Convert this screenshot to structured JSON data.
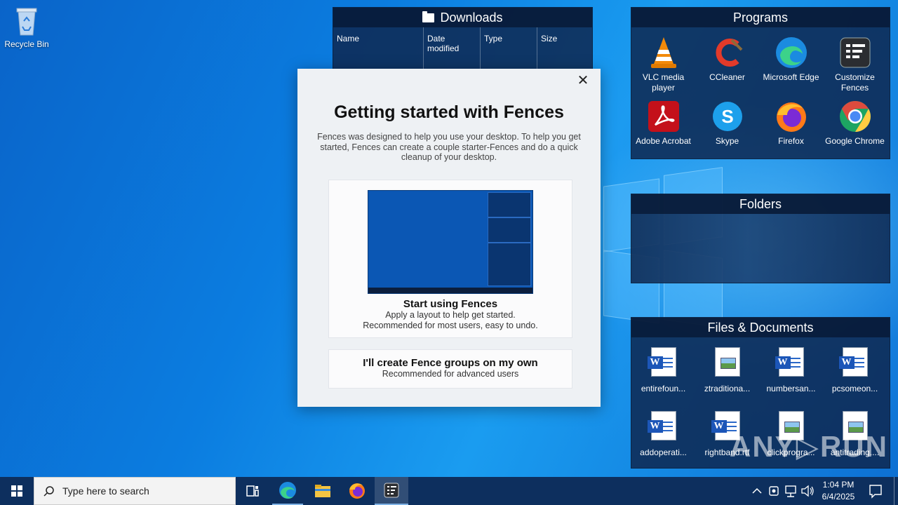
{
  "desktop": {
    "recycle_bin_label": "Recycle Bin"
  },
  "downloads_fence": {
    "title": "Downloads",
    "columns": [
      "Name",
      "Date modified",
      "Type",
      "Size"
    ]
  },
  "programs_fence": {
    "title": "Programs",
    "items": [
      {
        "label": "VLC media player",
        "icon": "vlc-icon"
      },
      {
        "label": "CCleaner",
        "icon": "ccleaner-icon"
      },
      {
        "label": "Microsoft Edge",
        "icon": "edge-icon"
      },
      {
        "label": "Customize Fences",
        "icon": "fences-icon"
      },
      {
        "label": "Adobe Acrobat",
        "icon": "acrobat-icon"
      },
      {
        "label": "Skype",
        "icon": "skype-icon"
      },
      {
        "label": "Firefox",
        "icon": "firefox-icon"
      },
      {
        "label": "Google Chrome",
        "icon": "chrome-icon"
      }
    ]
  },
  "folders_fence": {
    "title": "Folders"
  },
  "files_fence": {
    "title": "Files & Documents",
    "items": [
      {
        "label": "entirefoun...",
        "icon": "word-doc-icon"
      },
      {
        "label": "ztraditiona...",
        "icon": "image-file-icon"
      },
      {
        "label": "numbersan...",
        "icon": "word-doc-icon"
      },
      {
        "label": "pcsomeon...",
        "icon": "word-doc-icon"
      },
      {
        "label": "addoperati...",
        "icon": "word-doc-icon"
      },
      {
        "label": "rightband.rtf",
        "icon": "word-doc-icon"
      },
      {
        "label": "clickprogra...",
        "icon": "image-file-icon"
      },
      {
        "label": "antitrading....",
        "icon": "image-file-icon"
      }
    ]
  },
  "dialog": {
    "close_glyph": "✕",
    "title": "Getting started with Fences",
    "intro": "Fences was designed to help you use your desktop. To help you get started, Fences can create a couple starter-Fences and do a quick cleanup of your desktop.",
    "option1": {
      "title": "Start using Fences",
      "line1": "Apply a layout to help get started.",
      "line2": "Recommended for most users, easy to undo."
    },
    "option2": {
      "title": "I'll create Fence groups on my own",
      "subtitle": "Recommended for advanced users"
    }
  },
  "taskbar": {
    "search_placeholder": "Type here to search",
    "time": "1:04 PM",
    "date": "6/4/2025"
  },
  "watermark": "ANY▷RUN",
  "colors": {
    "taskbar": "#0d2f5e",
    "fence_bg": "#0e2850",
    "dialog_bg": "#eef1f4"
  }
}
